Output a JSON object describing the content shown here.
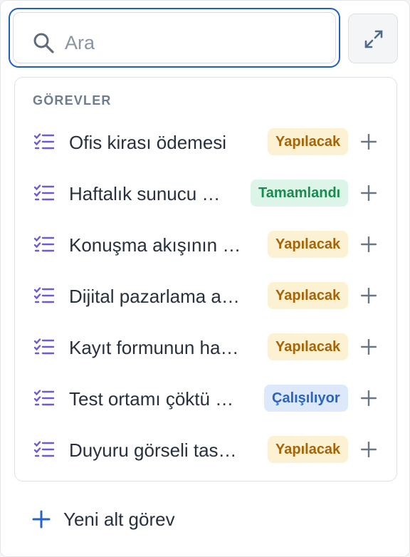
{
  "search": {
    "placeholder": "Ara"
  },
  "section": {
    "label": "GÖREVLER"
  },
  "tasks": [
    {
      "title": "Ofis kirası ödemesi",
      "status": "Yapılacak",
      "status_kind": "todo"
    },
    {
      "title": "Haftalık sunucu …",
      "status": "Tamamlandı",
      "status_kind": "done"
    },
    {
      "title": "Konuşma akışının …",
      "status": "Yapılacak",
      "status_kind": "todo"
    },
    {
      "title": "Dijital pazarlama a…",
      "status": "Yapılacak",
      "status_kind": "todo"
    },
    {
      "title": "Kayıt formunun ha…",
      "status": "Yapılacak",
      "status_kind": "todo"
    },
    {
      "title": "Test ortamı çöktü …",
      "status": "Çalışılıyor",
      "status_kind": "work"
    },
    {
      "title": "Duyuru görseli tas…",
      "status": "Yapılacak",
      "status_kind": "todo"
    }
  ],
  "footer": {
    "new_subtask_label": "Yeni alt görev"
  },
  "icons": {
    "search": "search-icon",
    "expand": "expand-icon",
    "task": "task-list-icon",
    "add": "plus-icon"
  },
  "colors": {
    "accent": "#1f5fbf",
    "task_icon": "#6b5bd6",
    "todo_bg": "#fdf1d3",
    "todo_text": "#a56406",
    "done_bg": "#dcf5e8",
    "done_text": "#1a8a50",
    "work_bg": "#dde9fb",
    "work_text": "#2b63c4"
  }
}
